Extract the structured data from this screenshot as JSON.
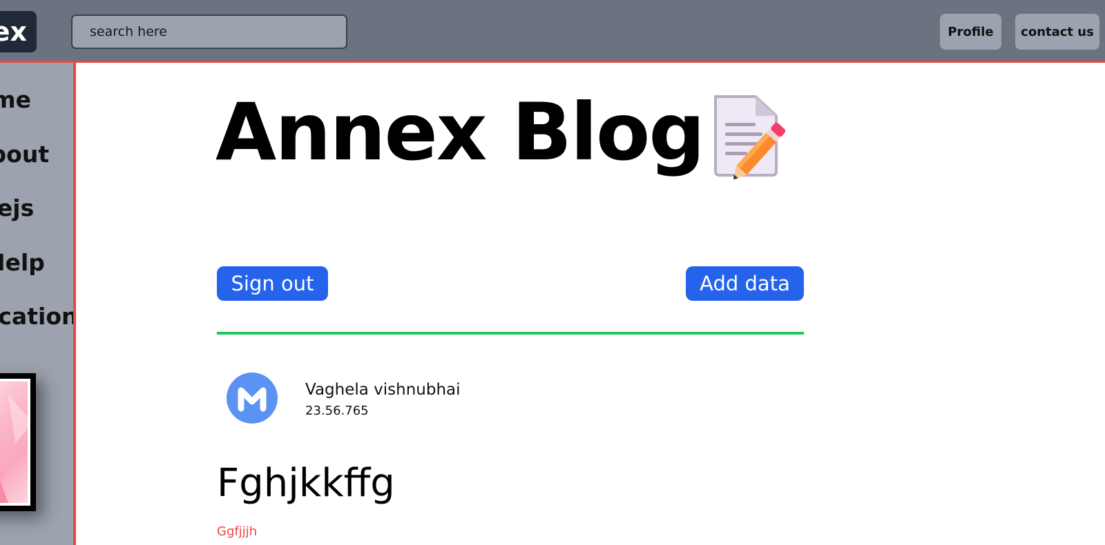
{
  "header": {
    "logo_text": "ex",
    "search_placeholder": "search here",
    "nav": {
      "profile_label": "Profile",
      "contact_label": "contact us"
    }
  },
  "sidebar": {
    "items": [
      {
        "label": "Home"
      },
      {
        "label": "About"
      },
      {
        "label": "Nodejs"
      },
      {
        "label": "Help"
      },
      {
        "label": "Application"
      }
    ]
  },
  "main": {
    "title": "Annex Blog",
    "title_icon": "memo-pencil-icon",
    "sign_out_label": "Sign out",
    "add_data_label": "Add data",
    "post": {
      "author": {
        "name": "Vaghela vishnubhai",
        "date": "23.56.765",
        "avatar_icon": "m-logo-icon"
      },
      "title": "Fghjkkffg",
      "subtitle": "Ggfjjjh"
    }
  },
  "colors": {
    "topbar": "#6b7280",
    "sidebar": "#9ca3af",
    "accent_red": "#ef4444",
    "button_blue": "#2563eb",
    "divider_green": "#22c55e",
    "avatar_blue": "#5b93f3"
  }
}
